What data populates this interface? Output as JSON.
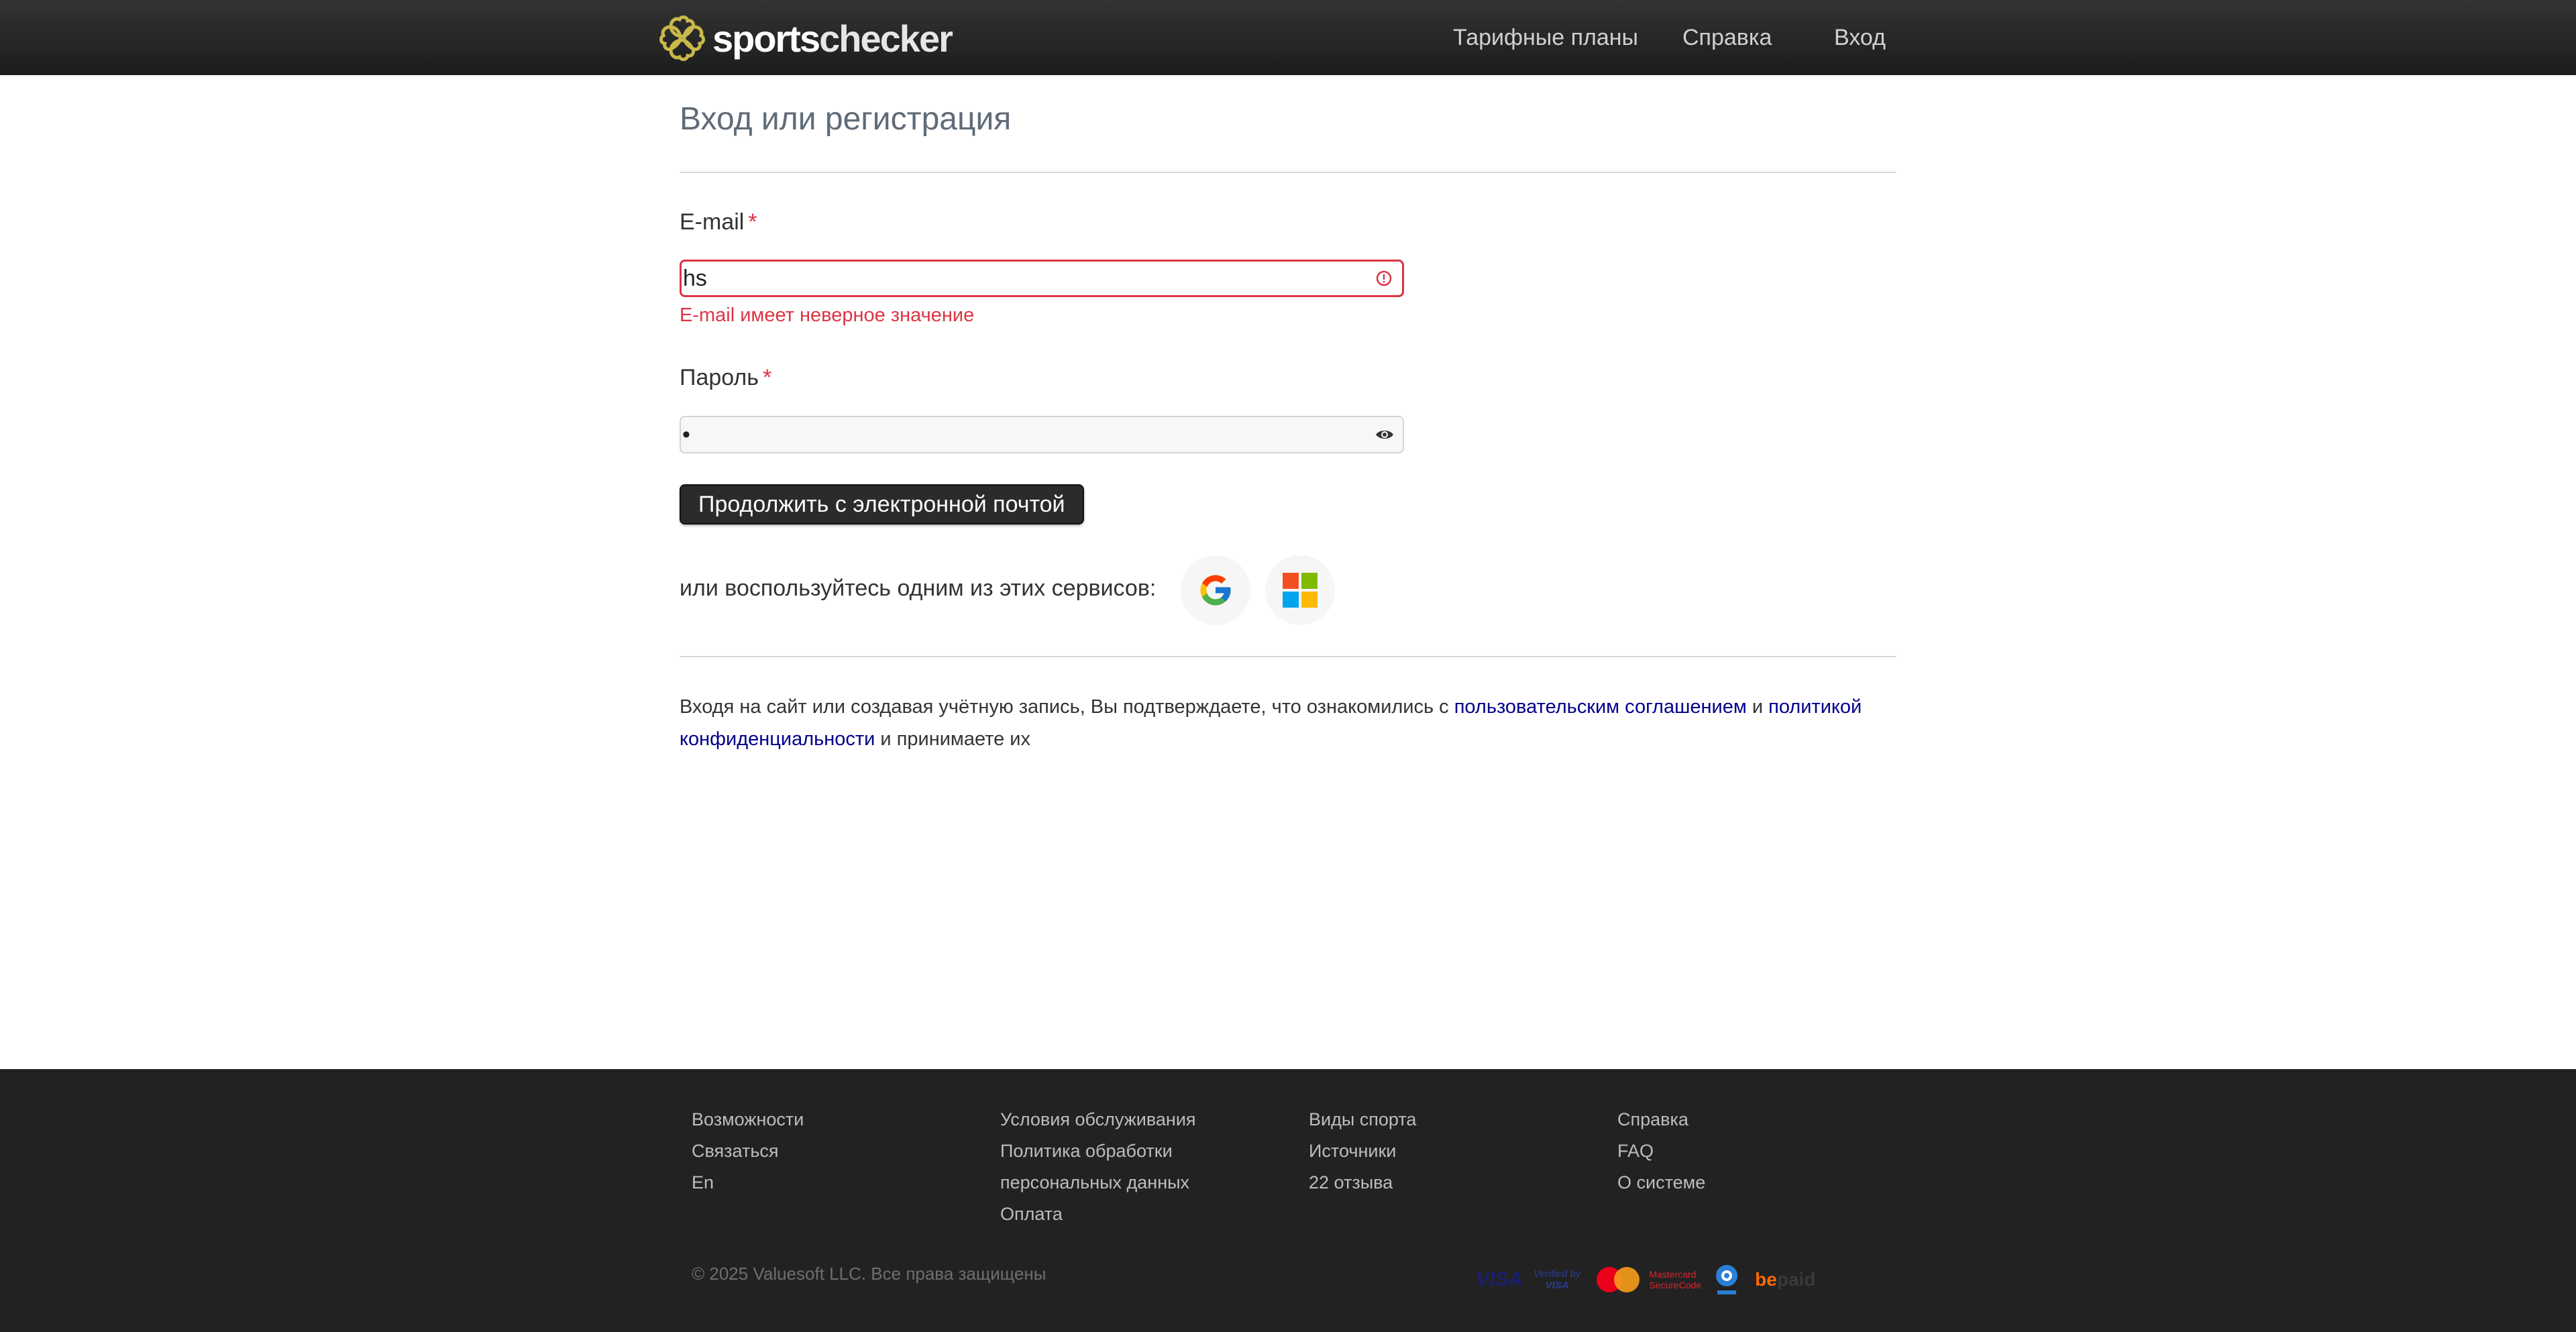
{
  "header": {
    "logo_prefix": "sports",
    "logo_suffix": "checker",
    "nav": {
      "plans": "Тарифные планы",
      "help": "Справка",
      "login": "Вход"
    }
  },
  "main": {
    "title": "Вход или регистрация",
    "email": {
      "label": "E-mail",
      "required_mark": "*",
      "value": "hs",
      "error": "E-mail имеет неверное значение",
      "icon": "error-circle-icon"
    },
    "password": {
      "label": "Пароль",
      "required_mark": "*",
      "value": "•",
      "icon": "eye-icon"
    },
    "continue_button": "Продолжить с электронной почтой",
    "or_services": "или воспользуйтесь одним из этих сервисов:",
    "social": [
      "google-icon",
      "microsoft-icon"
    ],
    "consent": {
      "text1": "Входя на сайт или создавая учётную запись, Вы подтверждаете, что ознакомились с ",
      "link1": "пользовательским соглашением",
      "text2": " и ",
      "link2": "политикой конфиденциальности",
      "text3": " и принимаете их"
    }
  },
  "footer": {
    "col1": [
      "Возможности",
      "Связаться",
      "En"
    ],
    "col2": [
      "Условия обслуживания",
      "Политика обработки",
      "персональных данных",
      "Оплата"
    ],
    "col3": [
      "Виды спорта",
      "Источники",
      "22 отзыва"
    ],
    "col4": [
      "Справка",
      "FAQ",
      "О системе"
    ],
    "copyright": "© 2025 Valuesoft LLC. Все права защищены",
    "payments": {
      "visa": "VISA",
      "vbv_line1": "Verified by",
      "vbv_line2": "VISA",
      "mc_line1": "Mastercard",
      "mc_line2": "SecureCode",
      "be": "be",
      "paid": "paid"
    }
  },
  "colors": {
    "header_bg": "#2a2a2a",
    "error": "#dc3545",
    "link": "#00008b",
    "footer_bg": "#222222",
    "logo_accent": "#c8b94a"
  }
}
